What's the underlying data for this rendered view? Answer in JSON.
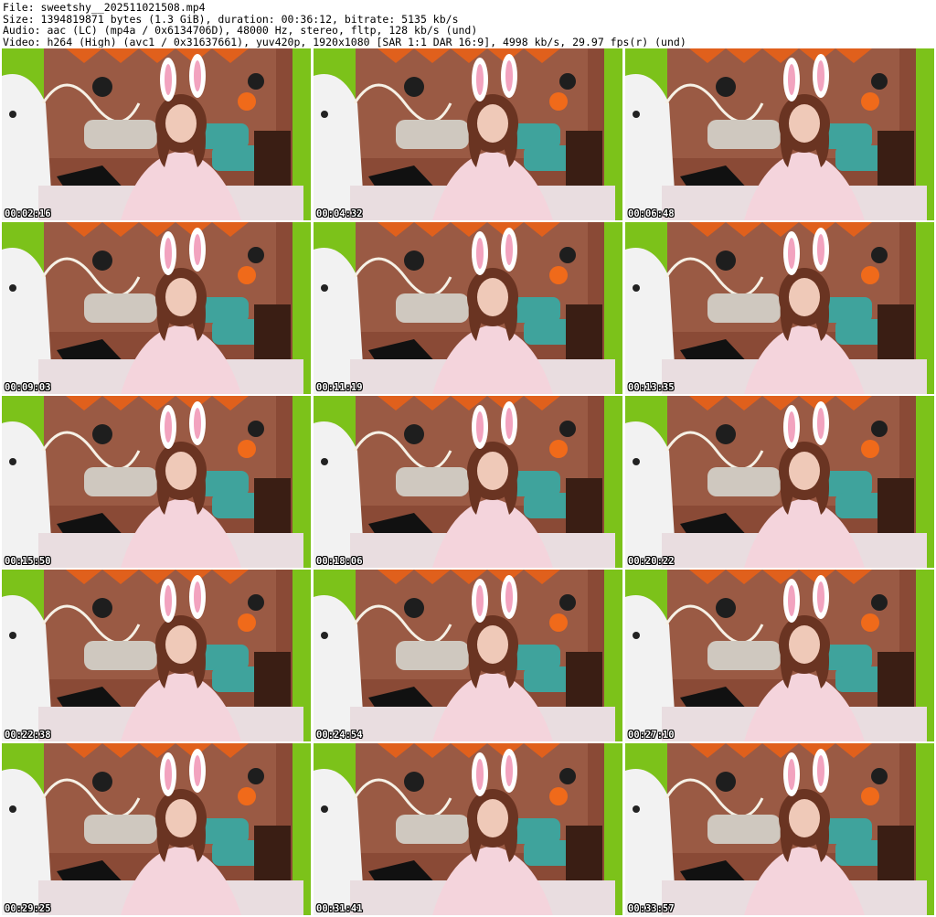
{
  "header": {
    "file_line": "File: sweetshy__202511021508.mp4",
    "size_line": "Size: 1394819871 bytes (1.3 GiB), duration: 00:36:12, bitrate: 5135 kb/s",
    "audio_line": "Audio: aac (LC) (mp4a / 0x6134706D), 48000 Hz, stereo, fltp, 128 kb/s (und)",
    "video_line": "Video: h264 (High) (avc1 / 0x31637661), yuv420p, 1920x1080 [SAR 1:1 DAR 16:9], 4998 kb/s, 29.97 fps(r) (und)"
  },
  "colors": {
    "background": "#ffffff",
    "text": "#000000",
    "timestamp": "#ffffff",
    "wall": "#8a4a36",
    "green_wall": "#7cc21a",
    "bed": "#e9dde0",
    "top": "#f4d4dc",
    "hair": "#6a3422"
  },
  "thumbnails": [
    {
      "time": "00:02:16"
    },
    {
      "time": "00:04:32"
    },
    {
      "time": "00:06:48"
    },
    {
      "time": "00:09:03"
    },
    {
      "time": "00:11:19"
    },
    {
      "time": "00:13:35"
    },
    {
      "time": "00:15:50"
    },
    {
      "time": "00:18:06"
    },
    {
      "time": "00:20:22"
    },
    {
      "time": "00:22:38"
    },
    {
      "time": "00:24:54"
    },
    {
      "time": "00:27:10"
    },
    {
      "time": "00:29:25"
    },
    {
      "time": "00:31:41"
    },
    {
      "time": "00:33:57"
    }
  ]
}
